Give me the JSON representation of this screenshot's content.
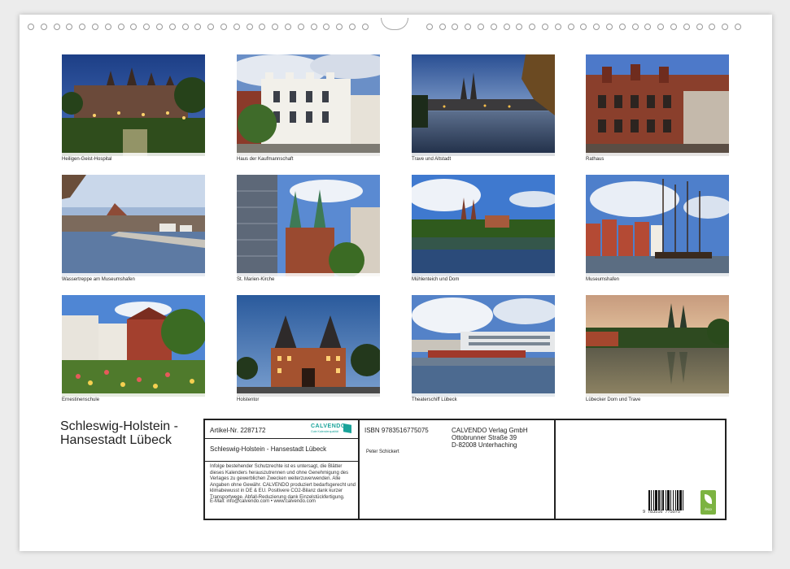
{
  "photos": [
    {
      "caption": "Heiligen-Geist-Hospital"
    },
    {
      "caption": "Haus der Kaufmannschaft"
    },
    {
      "caption": "Trave und Altstadt"
    },
    {
      "caption": "Rathaus"
    },
    {
      "caption": "Wassertreppe am Museumshafen"
    },
    {
      "caption": "St. Marien-Kirche"
    },
    {
      "caption": "Mühlenteich und Dom"
    },
    {
      "caption": "Museumshafen"
    },
    {
      "caption": "Ernestinenschule"
    },
    {
      "caption": "Holstentor"
    },
    {
      "caption": "Theaterschiff Lübeck"
    },
    {
      "caption": "Lübecker Dom und Trave"
    }
  ],
  "title_line1": "Schleswig-Holstein -",
  "title_line2": "Hansestadt Lübeck",
  "info": {
    "article": "Artikel-Nr. 2287172",
    "calvendo_logo": "CALVENDO",
    "calvendo_tagline": "Gute Kalenderqualität",
    "product_title": "Schleswig-Holstein - Hansestadt Lübeck",
    "legal_text": "Infolge bestehender Schutzrechte ist es untersagt, die Blätter dieses Kalenders herauszutrennen und ohne Genehmigung des Verlages zu gewerblichen Zwecken weiterzuverwenden. Alle Angaben ohne Gewähr. CALVENDO produziert bedarfsgerecht und klimabewusst in DE & EU. Positivere CO2-Bilanz dank kurzer Transportwege. Abfall-Reduzierung dank Einzelstückfertigung.",
    "email_line": "E-Mail: info@calvendo.com • www.calvendo.com",
    "isbn": "ISBN 9783516775075",
    "author": "Peter Schickert",
    "publisher": "CALVENDO Verlag GmbH",
    "street": "Ottobrunner Straße 39",
    "city": "D-82008 Unterhaching",
    "barcode_digits": "9  783516  775075",
    "eco_label": "feco"
  },
  "colors": {
    "frame": "#222222",
    "eco_green": "#7cb342",
    "calvendo_teal": "#1aa39a"
  }
}
